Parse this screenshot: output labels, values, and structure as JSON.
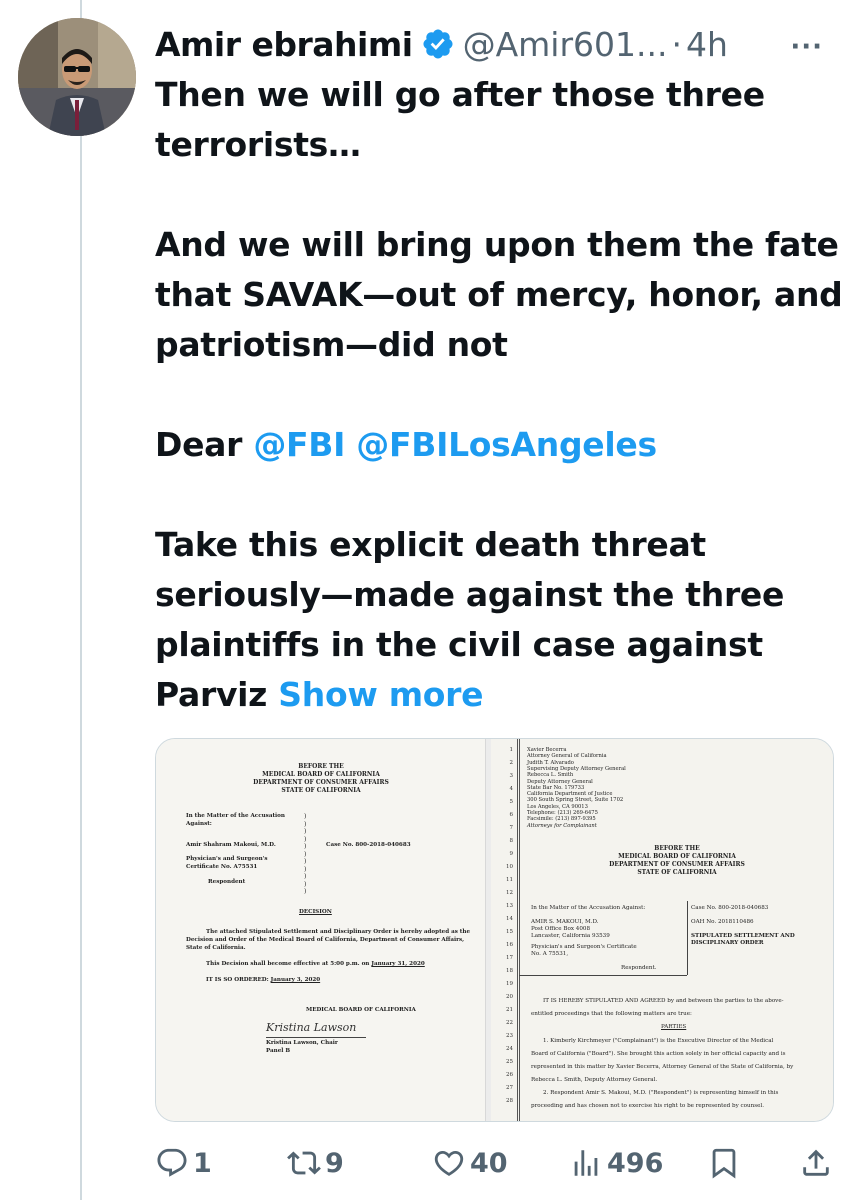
{
  "tweet": {
    "author_name": "Amir ebrahimi",
    "handle": "@Amir601...",
    "separator": "·",
    "time": "4h",
    "more_label": "···",
    "paragraphs": {
      "p1": "Then we will go after those three terrorists…",
      "p2": "And we will bring upon them the fate that SAVAK—out of mercy, honor, and patriotism—did not",
      "p3_prefix": "Dear ",
      "mention1": "@FBI",
      "mention2": "@FBILosAngeles",
      "p4": "Take this explicit death threat seriously—made against the three plaintiffs in the civil case against Parviz",
      "show_more": "Show more"
    },
    "accent_color": "#1d9bf0"
  },
  "doc_left": {
    "heading1": "BEFORE THE",
    "heading2": "MEDICAL BOARD OF CALIFORNIA",
    "heading3": "DEPARTMENT OF CONSUMER AFFAIRS",
    "heading4": "STATE OF CALIFORNIA",
    "matter1": "In the Matter of the Accusation",
    "matter2": "Against:",
    "respondent_name": "Amir Shahram Makoui, M.D.",
    "case_no": "Case No.  800-2018-040683",
    "cert1": "Physician's and Surgeon's",
    "cert2": "Certificate No.  A75531",
    "respondent_label": "Respondent",
    "decision_title": "DECISION",
    "decision1": "The attached Stipulated Settlement and Disciplinary Order is hereby adopted as the",
    "decision2": "Decision and Order of the Medical Board of California, Department of Consumer Affairs,",
    "decision3": "State of California.",
    "effective_prefix": "This Decision shall become effective at 5:00 p.m. on ",
    "effective_date": "January 31, 2020",
    "ordered_prefix": "IT IS SO ORDERED:  ",
    "ordered_date": "January 3, 2020",
    "board_sign": "MEDICAL BOARD OF CALIFORNIA",
    "signature": "Kristina Lawson",
    "signer1": "Kristina Lawson, Chair",
    "signer2": "Panel B"
  },
  "doc_right": {
    "line_numbers": [
      "1",
      "2",
      "3",
      "4",
      "5",
      "6",
      "7",
      "8",
      "9",
      "10",
      "11",
      "12",
      "13",
      "14",
      "15",
      "16",
      "17",
      "18",
      "19",
      "20",
      "21",
      "22",
      "23",
      "24",
      "25",
      "26",
      "27",
      "28"
    ],
    "attorney": [
      "Xavier Becerra",
      "Attorney General of California",
      "Judith T. Alvarado",
      "Supervising Deputy Attorney General",
      "Rebecca L. Smith",
      "Deputy Attorney General",
      "State Bar No. 179733",
      "California Department of Justice",
      "300 South Spring Street, Suite 1702",
      "Los Angeles, CA  90013",
      "Telephone:  (213) 269-6475",
      "Facsimile:  (213) 897-9395",
      "Attorneys for Complainant"
    ],
    "heading1": "BEFORE THE",
    "heading2": "MEDICAL BOARD OF CALIFORNIA",
    "heading3": "DEPARTMENT OF CONSUMER AFFAIRS",
    "heading4": "STATE OF CALIFORNIA",
    "matter": "In the Matter of the Accusation Against:",
    "resp1": "AMIR S. MAKOUI, M.D.",
    "resp2": "Post Office Box 4008",
    "resp3": "Lancaster, California 93539",
    "cert1": "Physician's and Surgeon's Certificate",
    "cert2": "No. A 75531,",
    "respondent_label": "Respondent.",
    "case_no": "Case No. 800-2018-040683",
    "oah_no": "OAH No. 2018110486",
    "stip1": "STIPULATED SETTLEMENT AND",
    "stip2": "DISCIPLINARY ORDER",
    "body1": "IT IS HEREBY STIPULATED AND AGREED by and between the parties to the above-",
    "body2": "entitled proceedings that the following matters are true:",
    "parties": "PARTIES",
    "body3": "1.     Kimberly Kirchmeyer (\"Complainant\") is the Executive Director of the Medical",
    "body4": "Board of California (\"Board\").  She brought this action solely in her official capacity and is",
    "body5": "represented in this matter by Xavier Becerra, Attorney General of the State of California, by",
    "body6": "Rebecca L. Smith, Deputy Attorney General.",
    "body7": "2.     Respondent Amir S. Makoui, M.D. (\"Respondent\") is representing himself in this",
    "body8": "proceeding and has chosen not to exercise his right to be represented by counsel."
  },
  "actions": {
    "reply_count": "1",
    "retweet_count": "9",
    "like_count": "40",
    "views_count": "496"
  }
}
